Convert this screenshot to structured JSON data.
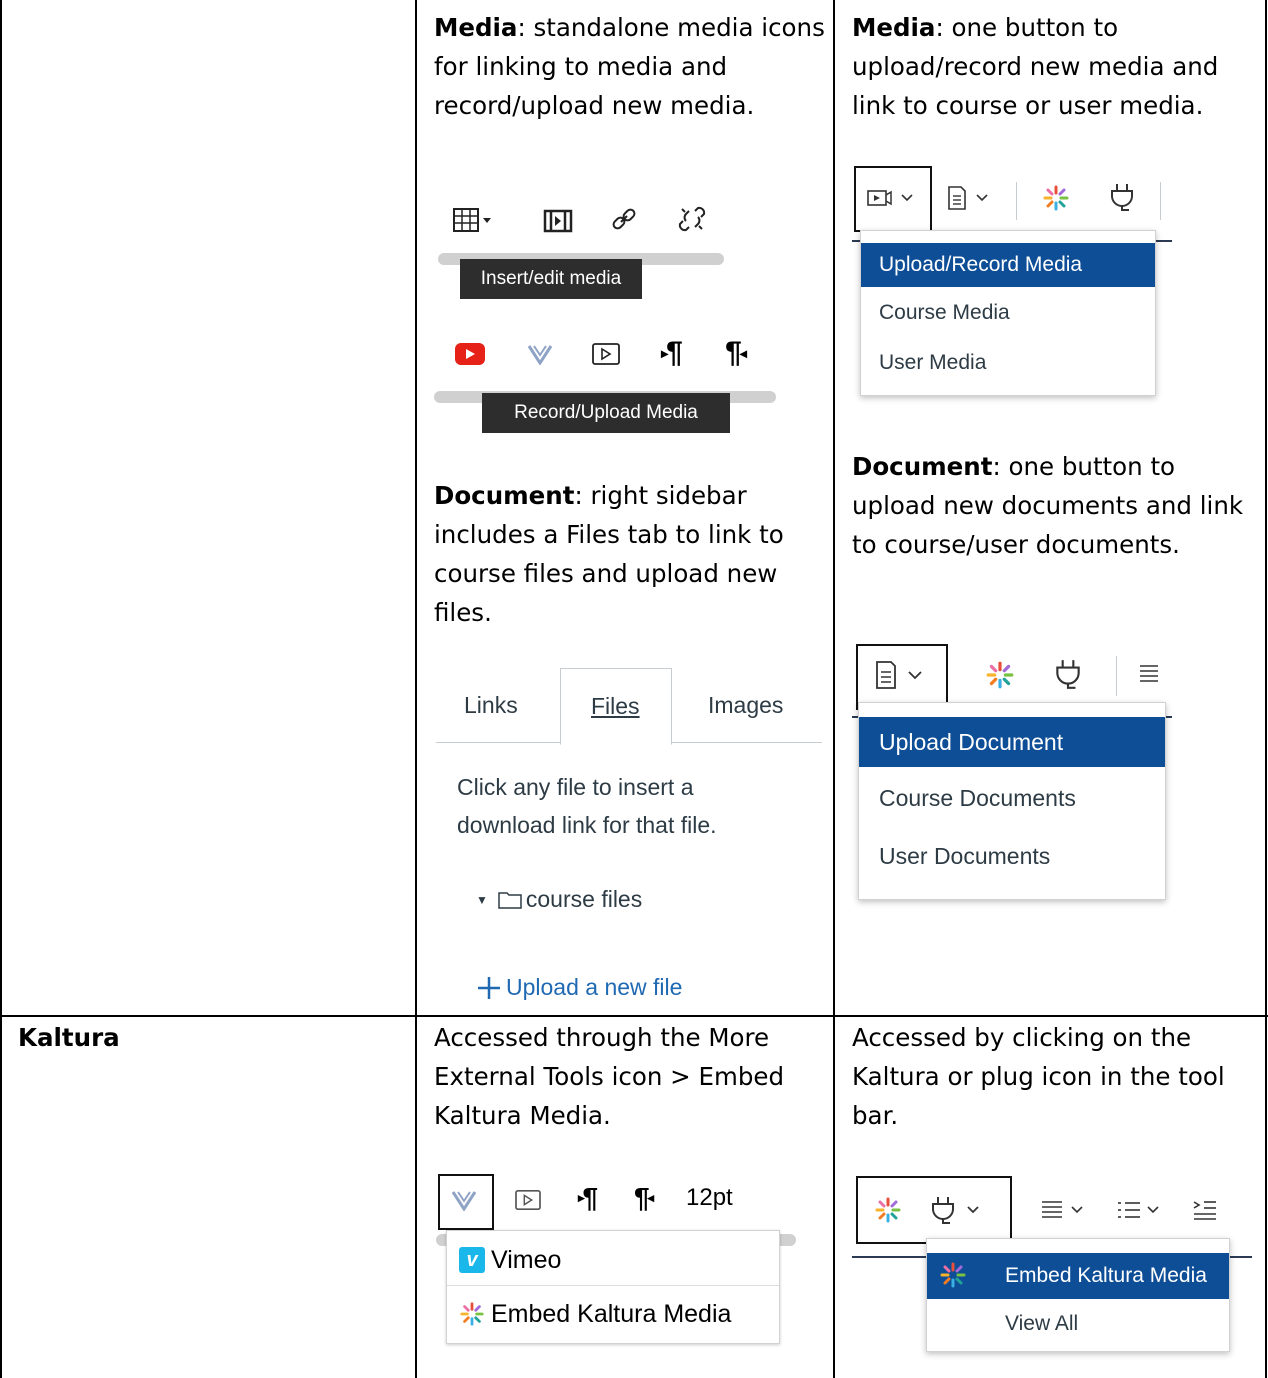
{
  "row1": {
    "col2": {
      "media_heading": "Media",
      "media_text": ": standalone media icons for linking to media and record/upload new media.",
      "tooltip_insert": "Insert/edit media",
      "tooltip_record": "Record/Upload Media",
      "doc_heading": "Document",
      "doc_text": ": right sidebar includes a Files tab to link to course files and upload new files.",
      "tabs": [
        "Links",
        "Files",
        "Images"
      ],
      "files_hint": "Click any file to insert a download link for that file.",
      "folder": "course files",
      "upload_link": "Upload a new file"
    },
    "col3": {
      "media_heading": "Media",
      "media_text": ": one button to upload/record new media and link to course or user media.",
      "media_menu": [
        "Upload/Record Media",
        "Course Media",
        "User Media"
      ],
      "doc_heading": "Document",
      "doc_text": ": one button to upload new documents and link to course/user documents.",
      "doc_menu": [
        "Upload Document",
        "Course Documents",
        "User Documents"
      ]
    }
  },
  "row2": {
    "col1": {
      "label": "Kaltura"
    },
    "col2": {
      "text": "Accessed through the More External Tools icon > Embed Kaltura Media.",
      "toolbar_size": "12pt",
      "menu": [
        "Vimeo",
        "Embed Kaltura Media"
      ]
    },
    "col3": {
      "text": "Accessed by clicking on the Kaltura or plug icon in the tool bar.",
      "menu": [
        "Embed Kaltura Media",
        "View All"
      ]
    }
  },
  "colors": {
    "menu_selected": "#0e4e96",
    "link_blue": "#1f69b3",
    "nav_line": "#2b3a55"
  }
}
